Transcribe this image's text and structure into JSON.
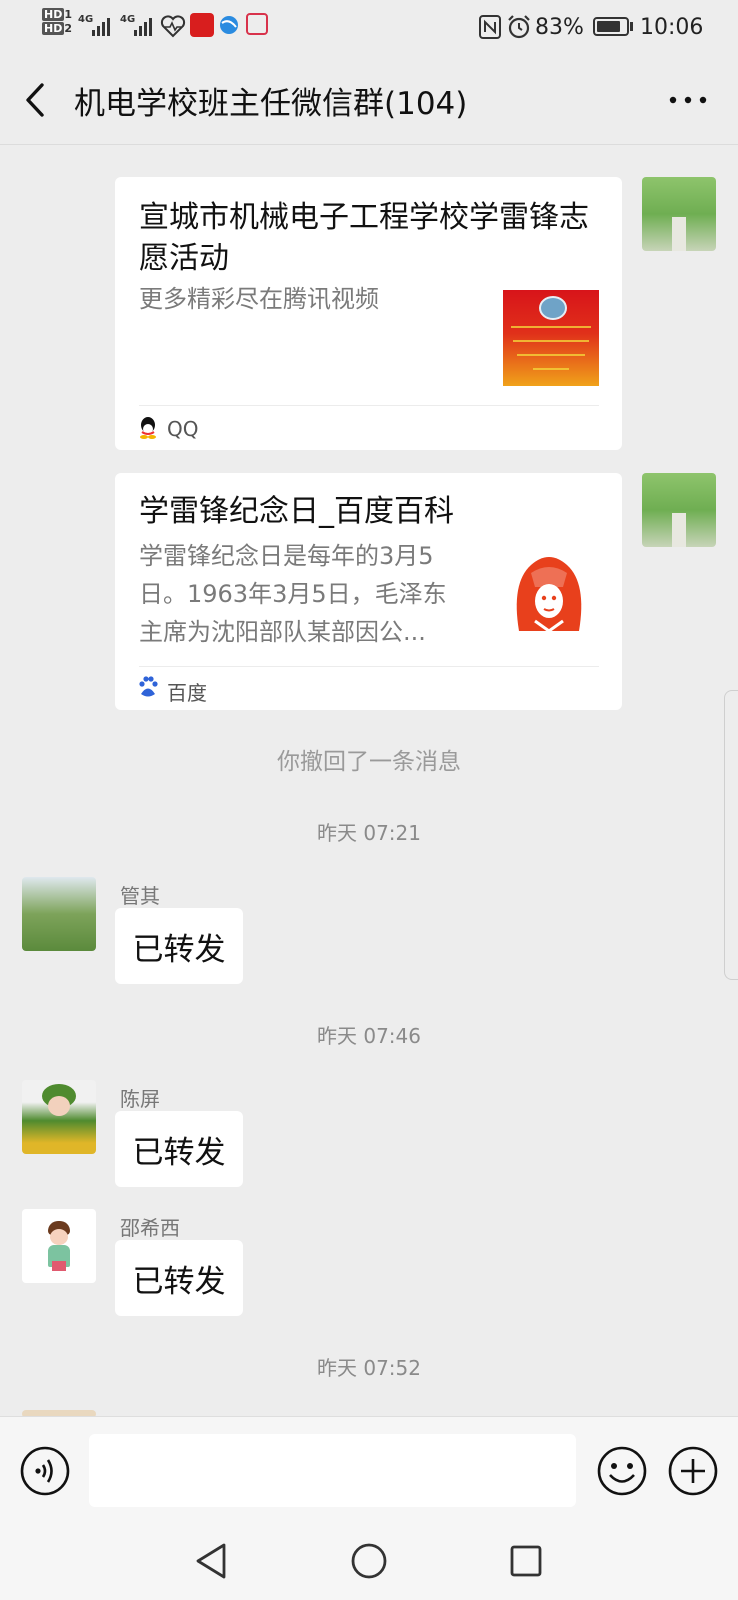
{
  "status_bar": {
    "hd1": "HD",
    "hd1_sub": "1",
    "hd2": "HD",
    "hd2_sub": "2",
    "net1": "4G",
    "net2": "4G",
    "battery": "83%",
    "time": "10:06",
    "battery_level": 0.83
  },
  "header": {
    "title": "机电学校班主任微信群(104)"
  },
  "messages": {
    "card1": {
      "title": "宣城市机械电子工程学校学雷锋志愿活动",
      "desc": "更多精彩尽在腾讯视频",
      "source": "QQ"
    },
    "card2": {
      "title": "学雷锋纪念日_百度百科",
      "desc": "学雷锋纪念日是每年的3月5日。1963年3月5日，毛泽东主席为沈阳部队某部因公...",
      "source": "百度"
    },
    "recall_notice": "你撤回了一条消息",
    "time1": "昨天 07:21",
    "msg1": {
      "sender": "管其",
      "text": "已转发"
    },
    "time2": "昨天 07:46",
    "msg2": {
      "sender": "陈屏",
      "text": "已转发"
    },
    "msg3": {
      "sender": "邵希西",
      "text": "已转发"
    },
    "time3": "昨天 07:52"
  },
  "colors": {
    "background": "#ededed",
    "bubble": "#ffffff",
    "accent_red": "#e8401c"
  },
  "icons": {
    "back": "chevron-left-icon",
    "more": "more-icon",
    "voice": "voice-icon",
    "emoji": "emoji-icon",
    "add": "add-icon"
  }
}
